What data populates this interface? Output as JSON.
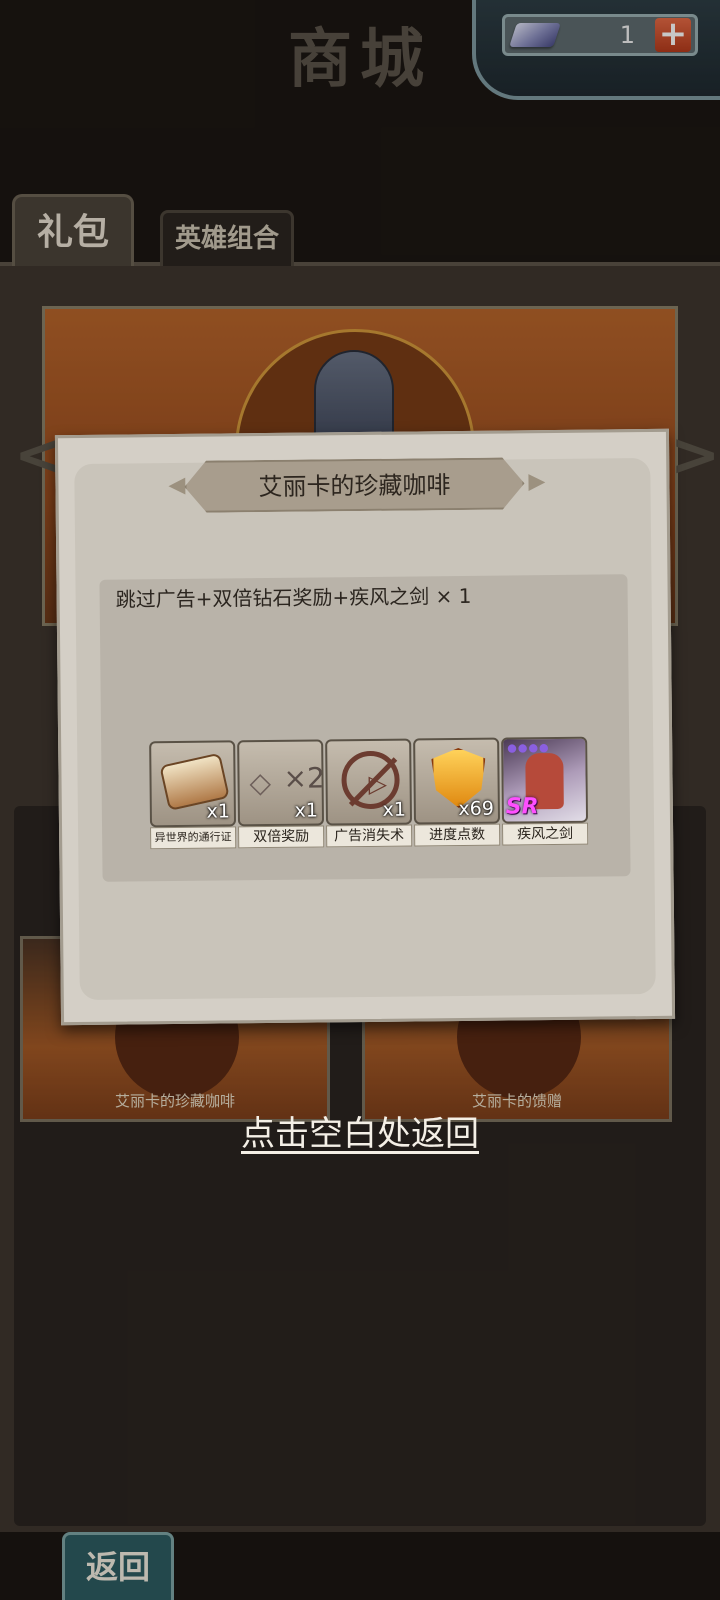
{
  "header": {
    "title": "商城"
  },
  "currency": {
    "amount": "1",
    "plus_label": "+"
  },
  "tabs": [
    {
      "label": "礼包"
    },
    {
      "label": "英雄组合"
    }
  ],
  "nav": {
    "left_arrow": "<",
    "right_arrow": ">"
  },
  "cards": [
    {
      "label": "艾丽卡的珍藏咖啡"
    },
    {
      "label": "艾丽卡的馈赠"
    }
  ],
  "back_button": {
    "label": "返回"
  },
  "modal": {
    "title": "艾丽卡的珍藏咖啡",
    "description": "跳过广告+双倍钻石奖励+疾风之剑 × 1",
    "items": [
      {
        "name": "异世界的通行证",
        "count": "x1",
        "icon": "scroll-icon"
      },
      {
        "name": "双倍奖励",
        "count": "x1",
        "icon": "diamond-icon",
        "icon_text": "×2"
      },
      {
        "name": "广告消失术",
        "count": "x1",
        "icon": "no-ad-icon"
      },
      {
        "name": "进度点数",
        "count": "x69",
        "icon": "shield-icon"
      },
      {
        "name": "疾风之剑",
        "count": "",
        "icon": "hero-portrait-icon",
        "rarity": "SR"
      }
    ]
  },
  "dismiss": {
    "label": "点击空白处返回"
  }
}
